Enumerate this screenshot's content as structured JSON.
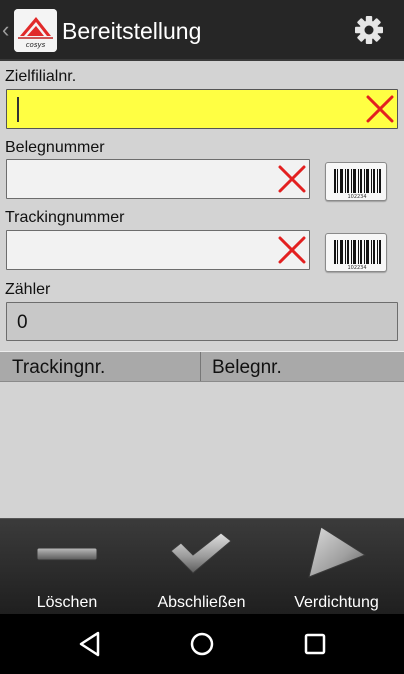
{
  "app": {
    "title": "Bereitstellung",
    "logo_text": "cosys",
    "back_glyph": "‹"
  },
  "form": {
    "target_branch": {
      "label": "Zielfilialnr.",
      "value": "",
      "placeholder": ""
    },
    "document_number": {
      "label": "Belegnummer",
      "value": "",
      "placeholder": ""
    },
    "tracking_number": {
      "label": "Trackingnummer",
      "value": "",
      "placeholder": ""
    },
    "counter": {
      "label": "Zähler",
      "value": "0"
    },
    "barcode_caption": "102234"
  },
  "table": {
    "columns": [
      "Trackingnr.",
      "Belegnr."
    ],
    "rows": []
  },
  "toolbar": {
    "delete_label": "Löschen",
    "finish_label": "Abschließen",
    "compress_label": "Verdichtung"
  },
  "icons": {
    "settings": "gear-icon",
    "clear": "clear-x-icon",
    "barcode": "barcode-icon",
    "delete": "minus-bar-icon",
    "finish": "checkmark-icon",
    "compress": "play-triangle-icon",
    "nav_back": "back-triangle-icon",
    "nav_home": "home-circle-icon",
    "nav_recents": "recents-square-icon"
  },
  "colors": {
    "active_field": "#ffff43",
    "clear_icon": "#e32020",
    "action_bar": "#262626",
    "toolbar": "#2d2d2d",
    "screen_bg": "#d3d3d3"
  }
}
